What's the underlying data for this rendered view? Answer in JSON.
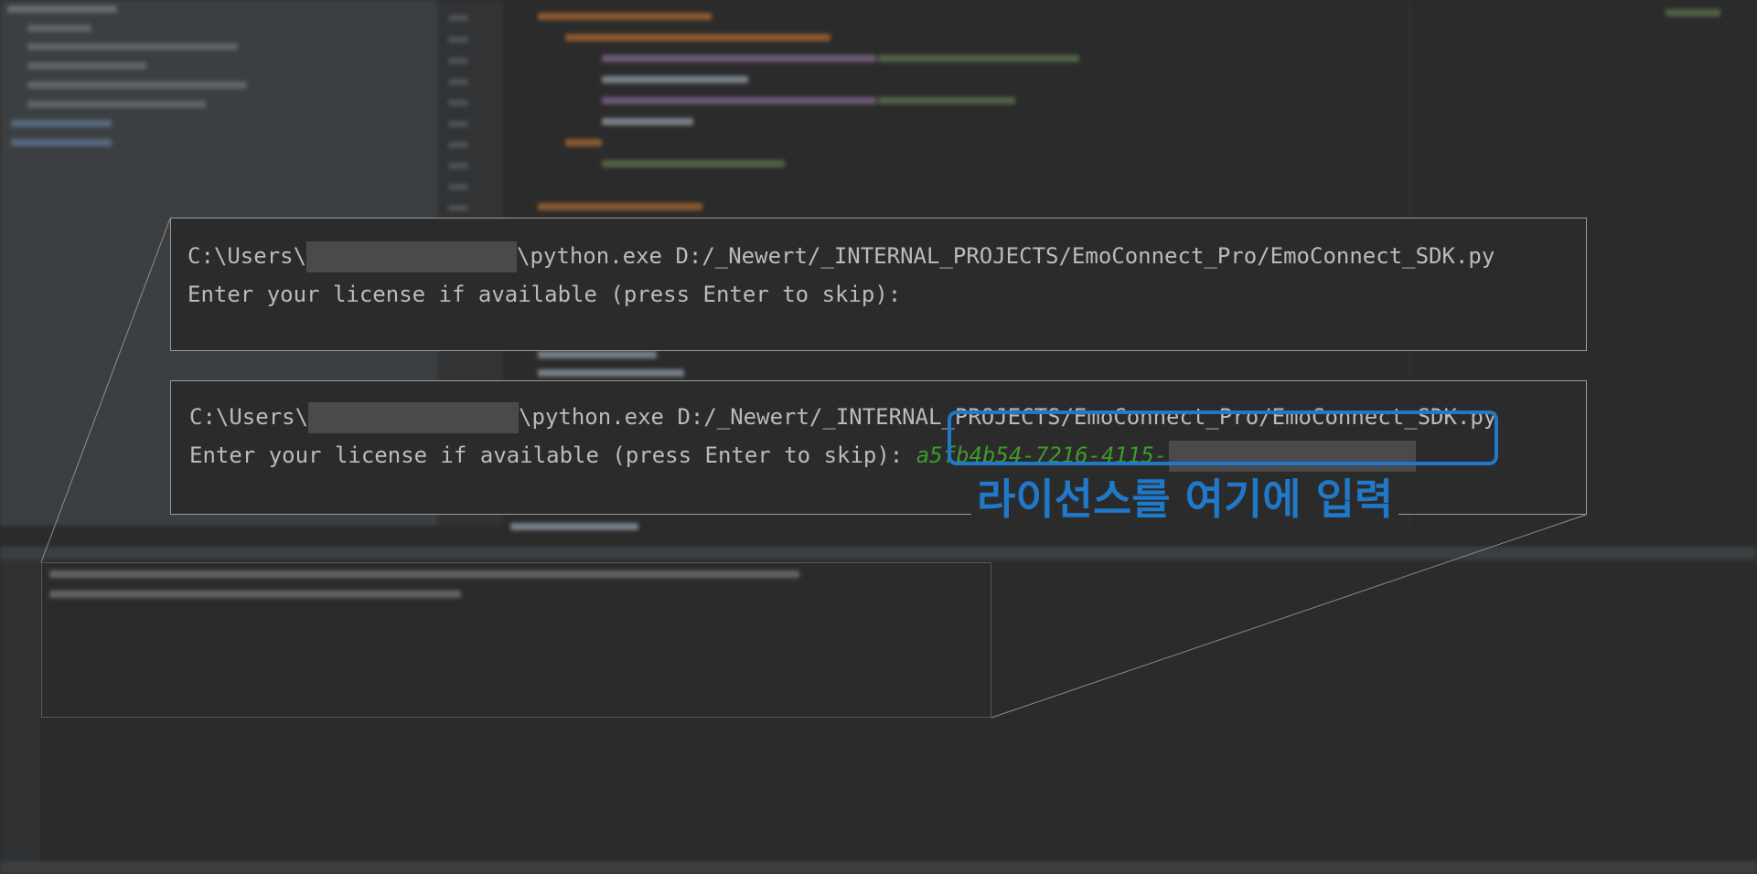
{
  "console_top": {
    "prefix": "C:\\Users\\",
    "suffix": "\\python.exe D:/_Newert/_INTERNAL_PROJECTS/EmoConnect_Pro/EmoConnect_SDK.py",
    "prompt": "Enter your license if available (press Enter to skip):"
  },
  "console_bottom": {
    "prefix": "C:\\Users\\",
    "suffix": "\\python.exe D:/_Newert/_INTERNAL_PROJECTS/EmoConnect_Pro/EmoConnect_SDK.py",
    "prompt": "Enter your license if available (press Enter to skip):",
    "license_value": "a5fb4b54-7216-4115-"
  },
  "caption": "라이선스를 여기에 입력",
  "colors": {
    "accent": "#1f78c8",
    "license_text": "#3d9a2e",
    "background": "#2b2b2b",
    "console_text": "#bbbbbb"
  }
}
